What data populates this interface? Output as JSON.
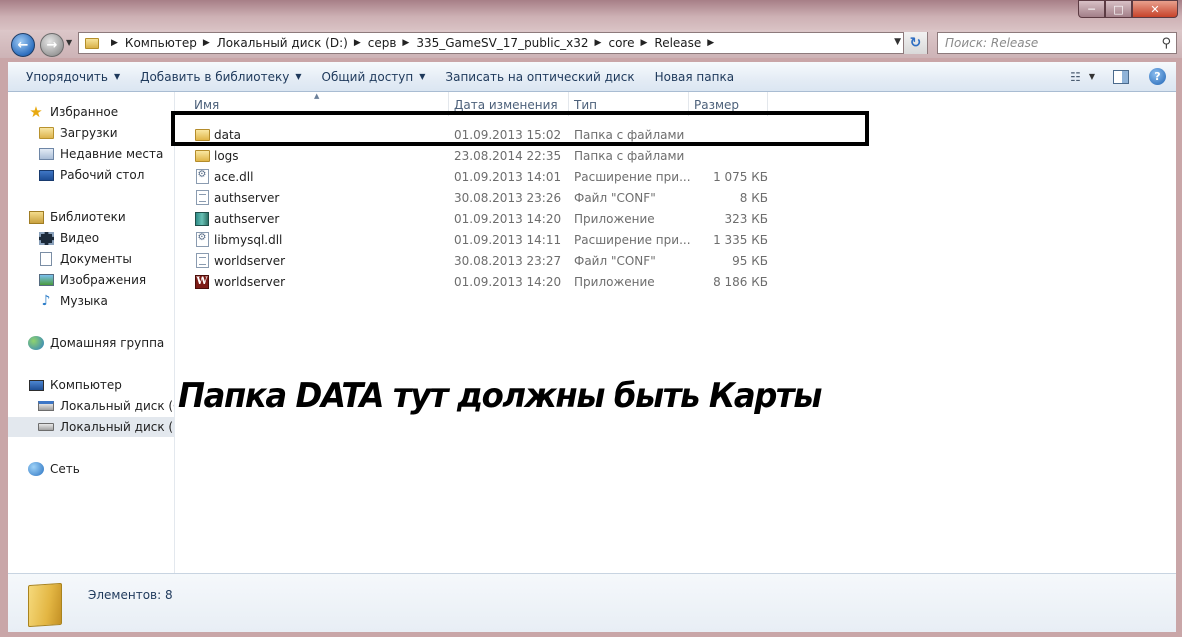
{
  "window": {
    "min_label": "─",
    "max_label": "□",
    "close_label": "✕"
  },
  "address": {
    "crumbs": [
      "Компьютер",
      "Локальный диск  (D:)",
      "серв",
      "335_GameSV_17_public_x32",
      "core",
      "Release"
    ]
  },
  "search": {
    "placeholder": "Поиск: Release"
  },
  "toolbar": {
    "organize": "Упорядочить",
    "add_library": "Добавить в библиотеку",
    "share": "Общий доступ",
    "burn": "Записать на оптический диск",
    "new_folder": "Новая папка"
  },
  "nav": {
    "favorites": "Избранное",
    "downloads": "Загрузки",
    "recent": "Недавние места",
    "desktop": "Рабочий стол",
    "libraries": "Библиотеки",
    "video": "Видео",
    "documents": "Документы",
    "images": "Изображения",
    "music": "Музыка",
    "homegroup": "Домашняя группа",
    "computer": "Компьютер",
    "disk_c": "Локальный диск (C:)",
    "disk_d": "Локальный диск  (D:)",
    "network": "Сеть"
  },
  "columns": {
    "name": "Имя",
    "date": "Дата изменения",
    "type": "Тип",
    "size": "Размер"
  },
  "files": [
    {
      "name": "data",
      "date": "01.09.2013 15:02",
      "type": "Папка с файлами",
      "size": "",
      "icon": "folder-icon"
    },
    {
      "name": "logs",
      "date": "23.08.2014 22:35",
      "type": "Папка с файлами",
      "size": "",
      "icon": "folder-icon"
    },
    {
      "name": "ace.dll",
      "date": "01.09.2013 14:01",
      "type": "Расширение при...",
      "size": "1 075 КБ",
      "icon": "dll-icon"
    },
    {
      "name": "authserver",
      "date": "30.08.2013 23:26",
      "type": "Файл \"CONF\"",
      "size": "8 КБ",
      "icon": "conf-file-icon"
    },
    {
      "name": "authserver",
      "date": "01.09.2013 14:20",
      "type": "Приложение",
      "size": "323 КБ",
      "icon": "authserver-app-icon"
    },
    {
      "name": "libmysql.dll",
      "date": "01.09.2013 14:11",
      "type": "Расширение при...",
      "size": "1 335 КБ",
      "icon": "dll-icon"
    },
    {
      "name": "worldserver",
      "date": "30.08.2013 23:27",
      "type": "Файл \"CONF\"",
      "size": "95 КБ",
      "icon": "conf-file-icon"
    },
    {
      "name": "worldserver",
      "date": "01.09.2013 14:20",
      "type": "Приложение",
      "size": "8 186 КБ",
      "icon": "worldserver-app-icon"
    }
  ],
  "annotation": "Папка DATA тут должны быть Карты",
  "details": {
    "items_count": "Элементов: 8"
  }
}
